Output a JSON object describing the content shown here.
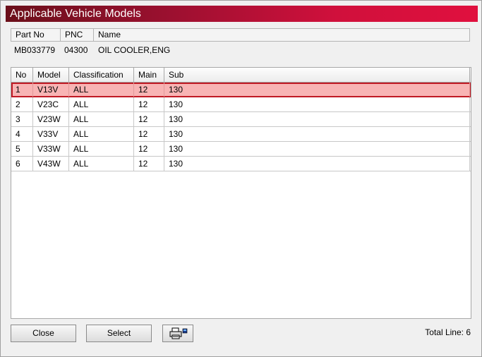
{
  "window": {
    "title": "Applicable Vehicle Models"
  },
  "part": {
    "headers": [
      "Part No",
      "PNC",
      "Name"
    ],
    "part_no": "MB033779",
    "pnc": "04300",
    "name": "OIL COOLER,ENG"
  },
  "grid": {
    "columns": [
      "No",
      "Model",
      "Classification",
      "Main",
      "Sub"
    ],
    "rows": [
      {
        "no": "1",
        "model": "V13V",
        "classification": "ALL",
        "main": "12",
        "sub": "130",
        "selected": true
      },
      {
        "no": "2",
        "model": "V23C",
        "classification": "ALL",
        "main": "12",
        "sub": "130",
        "selected": false
      },
      {
        "no": "3",
        "model": "V23W",
        "classification": "ALL",
        "main": "12",
        "sub": "130",
        "selected": false
      },
      {
        "no": "4",
        "model": "V33V",
        "classification": "ALL",
        "main": "12",
        "sub": "130",
        "selected": false
      },
      {
        "no": "5",
        "model": "V33W",
        "classification": "ALL",
        "main": "12",
        "sub": "130",
        "selected": false
      },
      {
        "no": "6",
        "model": "V43W",
        "classification": "ALL",
        "main": "12",
        "sub": "130",
        "selected": false
      }
    ]
  },
  "footer": {
    "close_label": "Close",
    "select_label": "Select",
    "print_icon": "printer-icon",
    "total_label": "Total Line: 6"
  },
  "colors": {
    "title_gradient_start": "#6b0f1a",
    "title_gradient_end": "#e0103e",
    "selected_row_bg": "#f8b4b4",
    "selected_row_border": "#c01a24"
  }
}
